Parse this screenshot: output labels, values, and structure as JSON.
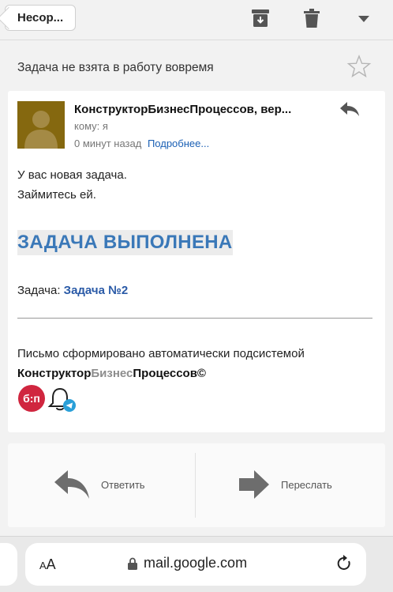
{
  "toolbar": {
    "back_label": "Несор...",
    "icons": [
      "archive-icon",
      "trash-icon",
      "dropdown-arrow-icon"
    ]
  },
  "message": {
    "subject": "Задача не взята в работу вовремя",
    "sender": "КонструкторБизнесПроцессов, вер...",
    "to": "кому: я",
    "time": "0 минут назад",
    "details_link": "Подробнее...",
    "body_line1": "У вас новая задача.",
    "body_line2": "Займитесь ей.",
    "heading": "ЗАДАЧА ВЫПОЛНЕНА",
    "task_label": "Задача:",
    "task_link": "Задача №2",
    "footer_line": "Письмо сформировано автоматически подсистемой",
    "brand_part1": "Конструктор",
    "brand_part2": "Бизнес",
    "brand_part3": "Процессов©",
    "logo_text": "б:п"
  },
  "actions": {
    "reply_label": "Ответить",
    "forward_label": "Переслать"
  },
  "browser": {
    "text_size": "AA",
    "url": "mail.google.com"
  },
  "colors": {
    "link": "#1a5fb4",
    "heading": "#3a78b8",
    "logo_red": "#d0263f",
    "avatar_bg": "#85680f"
  }
}
